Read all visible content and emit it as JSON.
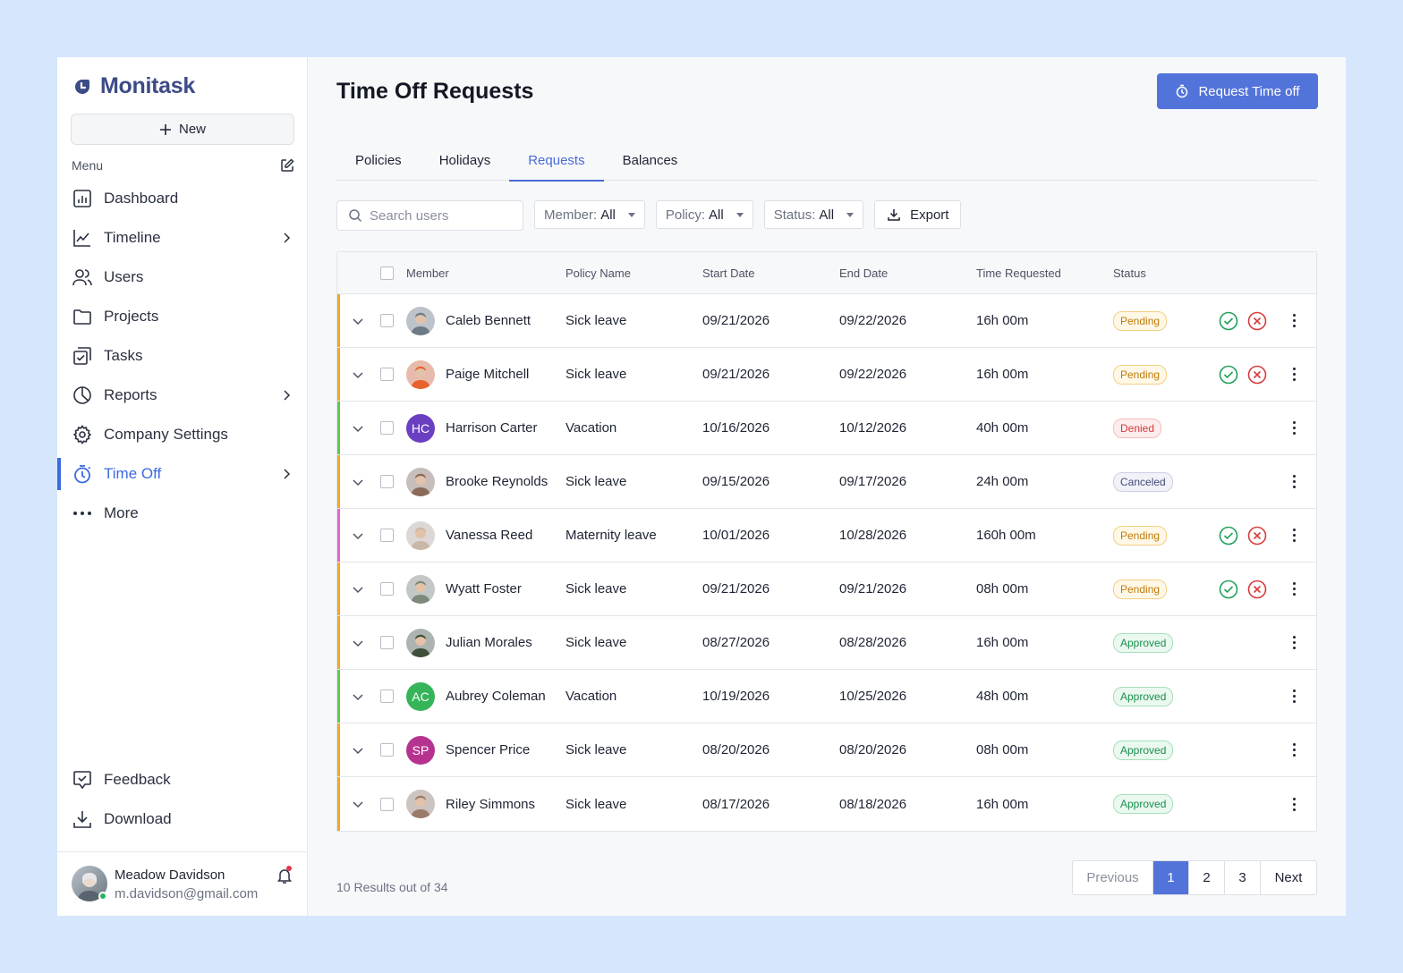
{
  "app": {
    "name": "Monitask",
    "brand_color": "#3d4b86",
    "accent_color": "#5273d9"
  },
  "sidebar": {
    "new_label": "New",
    "menu_label": "Menu",
    "items": [
      {
        "label": "Dashboard",
        "icon": "dashboard-icon",
        "chevron": false
      },
      {
        "label": "Timeline",
        "icon": "timeline-icon",
        "chevron": true
      },
      {
        "label": "Users",
        "icon": "users-icon",
        "chevron": false
      },
      {
        "label": "Projects",
        "icon": "folder-icon",
        "chevron": false
      },
      {
        "label": "Tasks",
        "icon": "tasks-icon",
        "chevron": false
      },
      {
        "label": "Reports",
        "icon": "pie-chart-icon",
        "chevron": true
      },
      {
        "label": "Company Settings",
        "icon": "gear-icon",
        "chevron": false
      },
      {
        "label": "Time Off",
        "icon": "stopwatch-icon",
        "chevron": true,
        "active": true
      },
      {
        "label": "More",
        "icon": "more-icon",
        "chevron": false
      }
    ],
    "bottom_items": [
      {
        "label": "Feedback",
        "icon": "feedback-icon"
      },
      {
        "label": "Download",
        "icon": "download-icon"
      }
    ],
    "user": {
      "name": "Meadow Davidson",
      "email": "m.davidson@gmail.com"
    }
  },
  "header": {
    "title": "Time Off Requests",
    "request_button": "Request Time off"
  },
  "tabs": [
    {
      "label": "Policies"
    },
    {
      "label": "Holidays"
    },
    {
      "label": "Requests",
      "active": true
    },
    {
      "label": "Balances"
    }
  ],
  "filters": {
    "search_placeholder": "Search users",
    "member": {
      "label": "Member:",
      "value": "All"
    },
    "policy": {
      "label": "Policy:",
      "value": "All"
    },
    "status": {
      "label": "Status:",
      "value": "All"
    },
    "export_label": "Export"
  },
  "table": {
    "columns": [
      "Member",
      "Policy Name",
      "Start Date",
      "End Date",
      "Time Requested",
      "Status"
    ],
    "rows": [
      {
        "name": "Caleb Bennett",
        "policy": "Sick leave",
        "start": "09/21/2026",
        "end": "09/22/2026",
        "time": "16h 00m",
        "status": "Pending",
        "bar": "#f5a623",
        "avatar": "photo",
        "avatar_color": "#6d7a86",
        "actions": true
      },
      {
        "name": "Paige Mitchell",
        "policy": "Sick leave",
        "start": "09/21/2026",
        "end": "09/22/2026",
        "time": "16h 00m",
        "status": "Pending",
        "bar": "#f5a623",
        "avatar": "photo",
        "avatar_color": "#e8622e",
        "actions": true
      },
      {
        "name": "Harrison Carter",
        "policy": "Vacation",
        "start": "10/16/2026",
        "end": "10/12/2026",
        "time": "40h 00m",
        "status": "Denied",
        "bar": "#5ccb4c",
        "avatar": "HC",
        "avatar_color": "#6a3fc2",
        "actions": false
      },
      {
        "name": "Brooke Reynolds",
        "policy": "Sick leave",
        "start": "09/15/2026",
        "end": "09/17/2026",
        "time": "24h 00m",
        "status": "Canceled",
        "bar": "#f5a623",
        "avatar": "photo",
        "avatar_color": "#8a6b5a",
        "actions": false
      },
      {
        "name": "Vanessa Reed",
        "policy": "Maternity leave",
        "start": "10/01/2026",
        "end": "10/28/2026",
        "time": "160h 00m",
        "status": "Pending",
        "bar": "#e865c8",
        "avatar": "photo",
        "avatar_color": "#c9b8a8",
        "actions": true
      },
      {
        "name": "Wyatt Foster",
        "policy": "Sick leave",
        "start": "09/21/2026",
        "end": "09/21/2026",
        "time": "08h 00m",
        "status": "Pending",
        "bar": "#f5a623",
        "avatar": "photo",
        "avatar_color": "#7d8a7a",
        "actions": true
      },
      {
        "name": "Julian Morales",
        "policy": "Sick leave",
        "start": "08/27/2026",
        "end": "08/28/2026",
        "time": "16h 00m",
        "status": "Approved",
        "bar": "#f5a623",
        "avatar": "photo",
        "avatar_color": "#3f4f3a",
        "actions": false
      },
      {
        "name": "Aubrey Coleman",
        "policy": "Vacation",
        "start": "10/19/2026",
        "end": "10/25/2026",
        "time": "48h 00m",
        "status": "Approved",
        "bar": "#5ccb4c",
        "avatar": "AC",
        "avatar_color": "#36b45a",
        "actions": false
      },
      {
        "name": "Spencer Price",
        "policy": "Sick leave",
        "start": "08/20/2026",
        "end": "08/20/2026",
        "time": "08h 00m",
        "status": "Approved",
        "bar": "#f5a623",
        "avatar": "SP",
        "avatar_color": "#b5338f",
        "actions": false
      },
      {
        "name": "Riley Simmons",
        "policy": "Sick leave",
        "start": "08/17/2026",
        "end": "08/18/2026",
        "time": "16h 00m",
        "status": "Approved",
        "bar": "#f5a623",
        "avatar": "photo",
        "avatar_color": "#9a7a68",
        "actions": false
      }
    ]
  },
  "footer": {
    "results_text": "10 Results out of 34",
    "pagination": {
      "previous": "Previous",
      "pages": [
        "1",
        "2",
        "3"
      ],
      "current": "1",
      "next": "Next"
    }
  }
}
